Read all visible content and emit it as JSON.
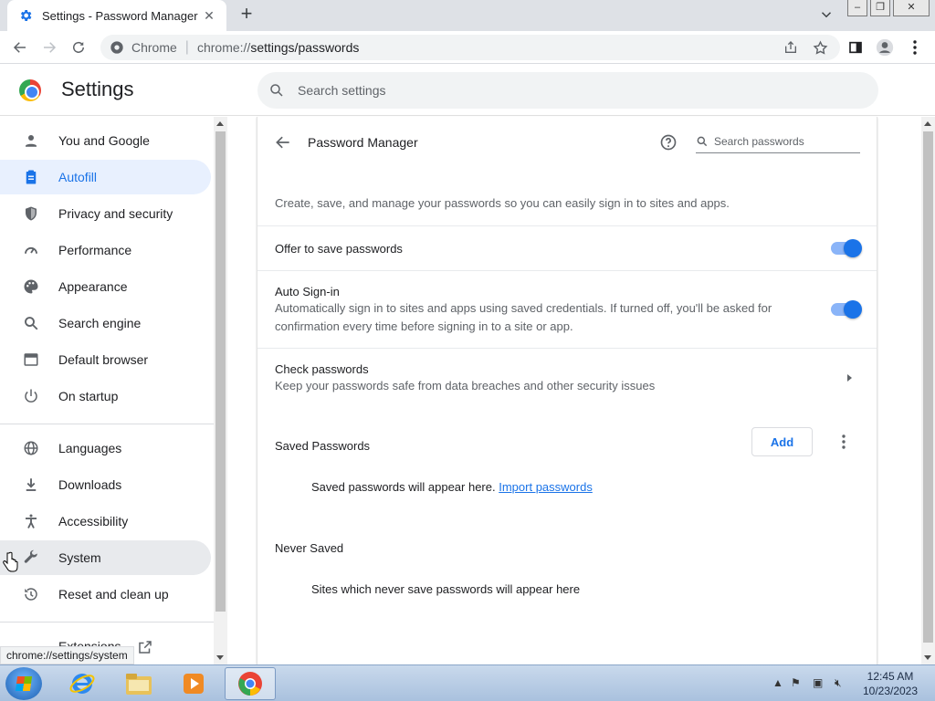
{
  "browser": {
    "tab_title": "Settings - Password Manager",
    "omnibox_site": "Chrome",
    "omnibox_url_prefix": "chrome://",
    "omnibox_url_path": "settings/passwords"
  },
  "header": {
    "title": "Settings",
    "search_placeholder": "Search settings"
  },
  "sidebar": {
    "items": [
      {
        "label": "You and Google",
        "icon": "person-icon"
      },
      {
        "label": "Autofill",
        "icon": "clipboard-icon"
      },
      {
        "label": "Privacy and security",
        "icon": "shield-icon"
      },
      {
        "label": "Performance",
        "icon": "speedometer-icon"
      },
      {
        "label": "Appearance",
        "icon": "palette-icon"
      },
      {
        "label": "Search engine",
        "icon": "search-icon"
      },
      {
        "label": "Default browser",
        "icon": "browser-window-icon"
      },
      {
        "label": "On startup",
        "icon": "power-icon"
      },
      {
        "label": "Languages",
        "icon": "globe-icon"
      },
      {
        "label": "Downloads",
        "icon": "download-icon"
      },
      {
        "label": "Accessibility",
        "icon": "accessibility-icon"
      },
      {
        "label": "System",
        "icon": "wrench-icon"
      },
      {
        "label": "Reset and clean up",
        "icon": "history-icon"
      },
      {
        "label": "Extensions",
        "icon": "puzzle-icon"
      }
    ],
    "active_item": "Autofill",
    "hovered_item": "System"
  },
  "password_manager": {
    "title": "Password Manager",
    "search_placeholder": "Search passwords",
    "description": "Create, save, and manage your passwords so you can easily sign in to sites and apps.",
    "offer_to_save": {
      "label": "Offer to save passwords",
      "enabled": true
    },
    "auto_signin": {
      "label": "Auto Sign-in",
      "sub": "Automatically sign in to sites and apps using saved credentials. If turned off, you'll be asked for confirmation every time before signing in to a site or app.",
      "enabled": true
    },
    "check_passwords": {
      "label": "Check passwords",
      "sub": "Keep your passwords safe from data breaches and other security issues"
    },
    "saved": {
      "title": "Saved Passwords",
      "add_label": "Add",
      "empty_text": "Saved passwords will appear here.",
      "import_link": "Import passwords"
    },
    "never_saved": {
      "title": "Never Saved",
      "empty_text": "Sites which never save passwords will appear here"
    }
  },
  "status_bar": {
    "url": "chrome://settings/system"
  },
  "taskbar": {
    "time": "12:45 AM",
    "date": "10/23/2023"
  },
  "colors": {
    "accent": "#1a73e8",
    "active_bg": "#e8f0fe"
  }
}
